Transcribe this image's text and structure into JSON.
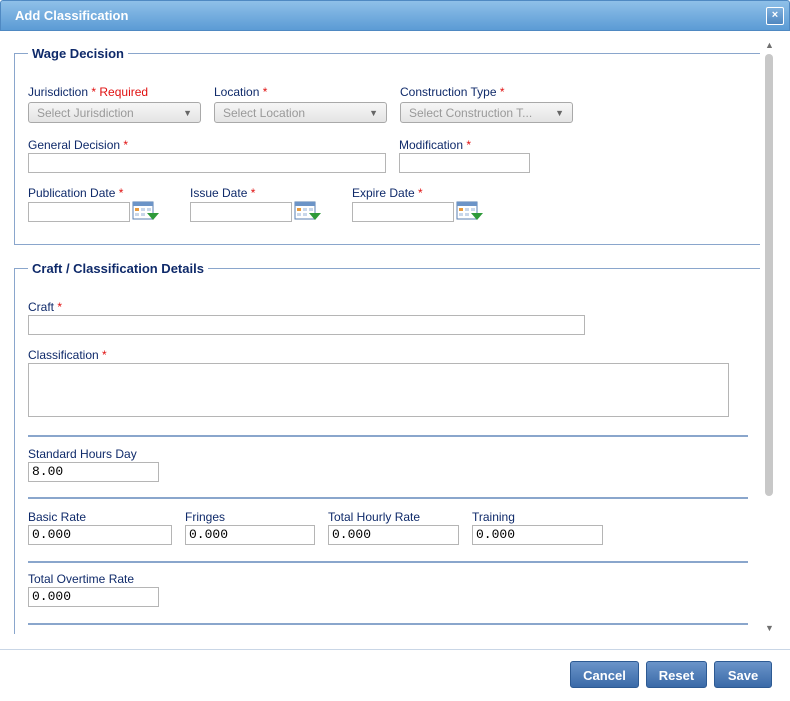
{
  "dialog": {
    "title": "Add Classification",
    "close_icon": "×"
  },
  "wage_decision": {
    "legend": "Wage Decision",
    "jurisdiction": {
      "label": "Jurisdiction",
      "required_mark": "* Required",
      "placeholder": "Select Jurisdiction"
    },
    "location": {
      "label": "Location",
      "required_mark": "*",
      "placeholder": "Select Location"
    },
    "construction_type": {
      "label": "Construction Type",
      "required_mark": "*",
      "placeholder": "Select Construction T..."
    },
    "general_decision": {
      "label": "General Decision",
      "required_mark": "*",
      "value": ""
    },
    "modification": {
      "label": "Modification",
      "required_mark": "*",
      "value": ""
    },
    "publication_date": {
      "label": "Publication Date",
      "required_mark": "*",
      "value": ""
    },
    "issue_date": {
      "label": "Issue Date",
      "required_mark": "*",
      "value": ""
    },
    "expire_date": {
      "label": "Expire Date",
      "required_mark": "*",
      "value": ""
    }
  },
  "craft_details": {
    "legend": "Craft / Classification Details",
    "craft": {
      "label": "Craft",
      "required_mark": "*",
      "value": ""
    },
    "classification": {
      "label": "Classification",
      "required_mark": "*",
      "value": ""
    },
    "standard_hours_day": {
      "label": "Standard Hours Day",
      "value": "8.00"
    },
    "basic_rate": {
      "label": "Basic Rate",
      "value": "0.000"
    },
    "fringes": {
      "label": "Fringes",
      "value": "0.000"
    },
    "total_hourly_rate": {
      "label": "Total Hourly Rate",
      "value": "0.000"
    },
    "training": {
      "label": "Training",
      "value": "0.000"
    },
    "total_overtime_rate": {
      "label": "Total Overtime Rate",
      "value": "0.000"
    }
  },
  "icons": {
    "dropdown": "chevron-down-icon",
    "calendar": "calendar-icon",
    "scroll_up": "▲",
    "scroll_down": "▼"
  },
  "buttons": {
    "cancel": "Cancel",
    "reset": "Reset",
    "save": "Save"
  },
  "colors": {
    "title_bar": "#5b9bd5",
    "button": "#3a6aa8",
    "label": "#0f2a6a",
    "required": "#e01010"
  }
}
